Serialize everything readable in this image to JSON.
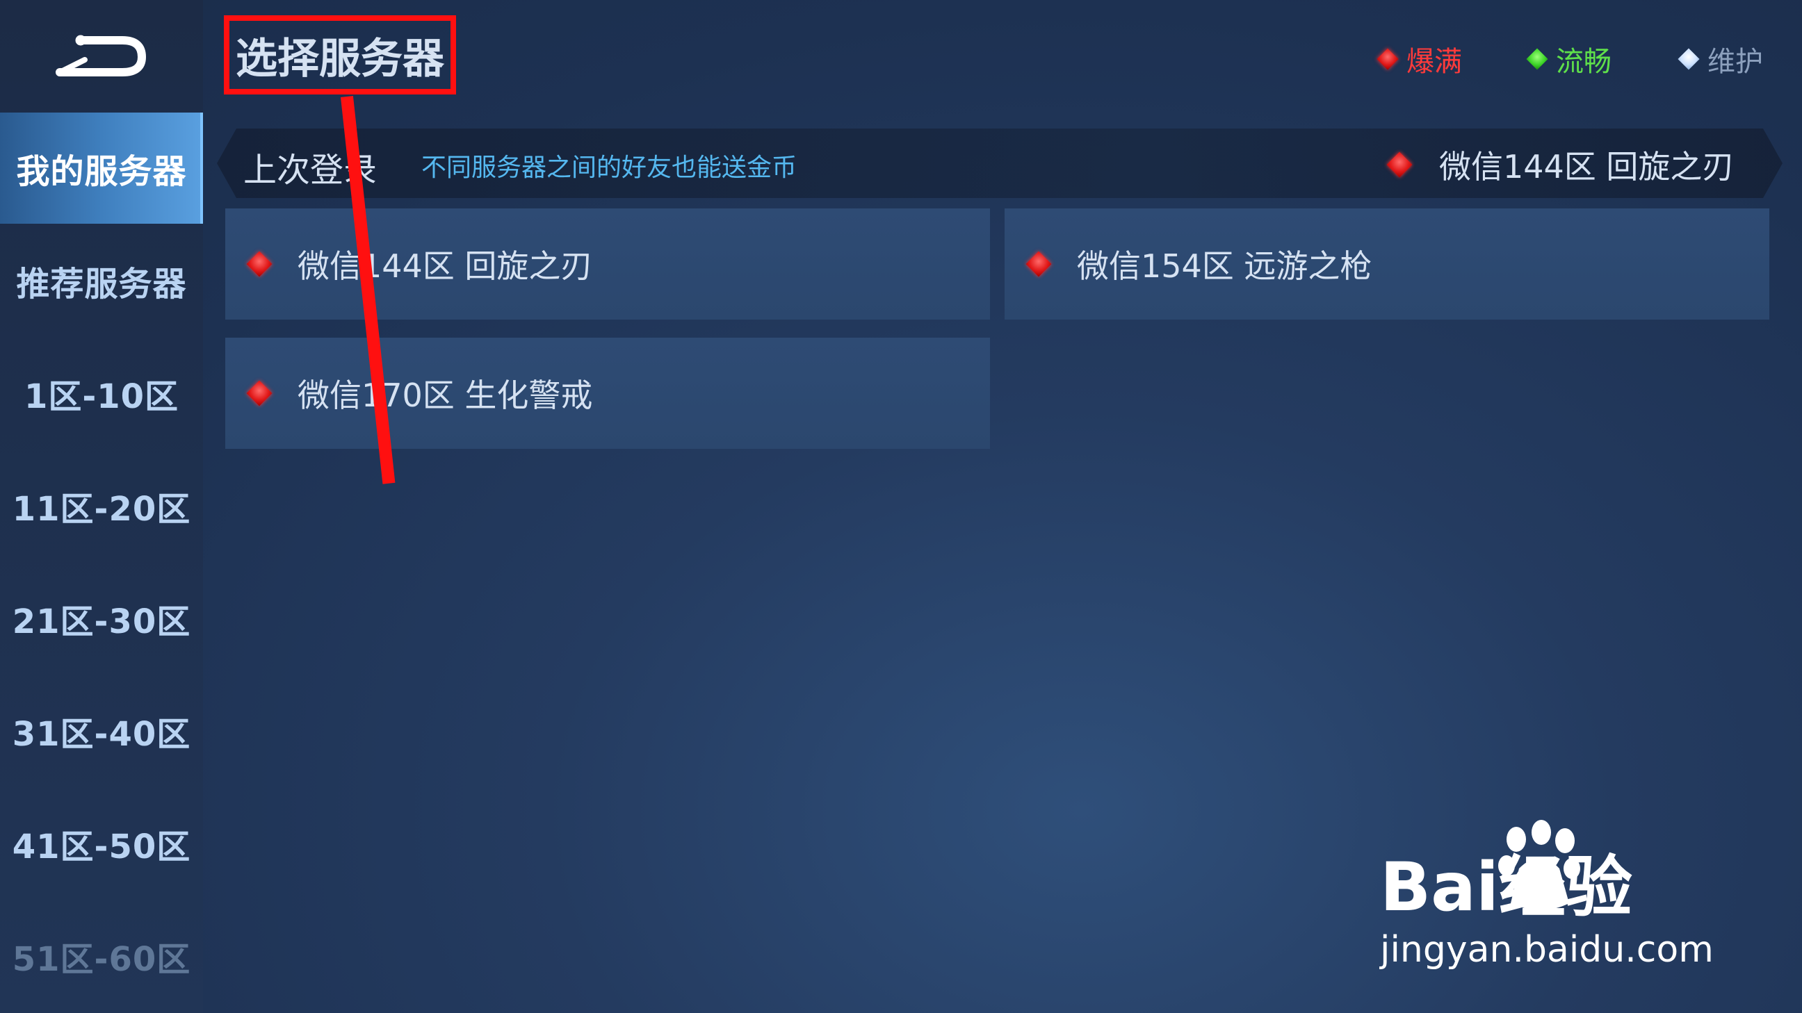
{
  "header": {
    "title": "选择服务器"
  },
  "legend": [
    {
      "label": "爆满",
      "color": "#ff3b3b"
    },
    {
      "label": "流畅",
      "color": "#5fe04a"
    },
    {
      "label": "维护",
      "color": "#8ca0bd"
    }
  ],
  "sidebar": {
    "items": [
      {
        "label": "我的服务器"
      },
      {
        "label": "推荐服务器"
      },
      {
        "label": "1区-10区"
      },
      {
        "label": "11区-20区"
      },
      {
        "label": "21区-30区"
      },
      {
        "label": "31区-40区"
      },
      {
        "label": "41区-50区"
      },
      {
        "label": "51区-60区"
      }
    ]
  },
  "last_login": {
    "label": "上次登录",
    "tip": "不同服务器之间的好友也能送金币",
    "server": "微信144区 回旋之刃"
  },
  "servers": [
    {
      "name": "微信144区 回旋之刃",
      "status": "爆满"
    },
    {
      "name": "微信154区 远游之枪",
      "status": "爆满"
    },
    {
      "name": "微信170区 生化警戒",
      "status": "爆满"
    }
  ],
  "watermark": {
    "brand": "Bai经验",
    "url": "jingyan.baidu.com"
  }
}
